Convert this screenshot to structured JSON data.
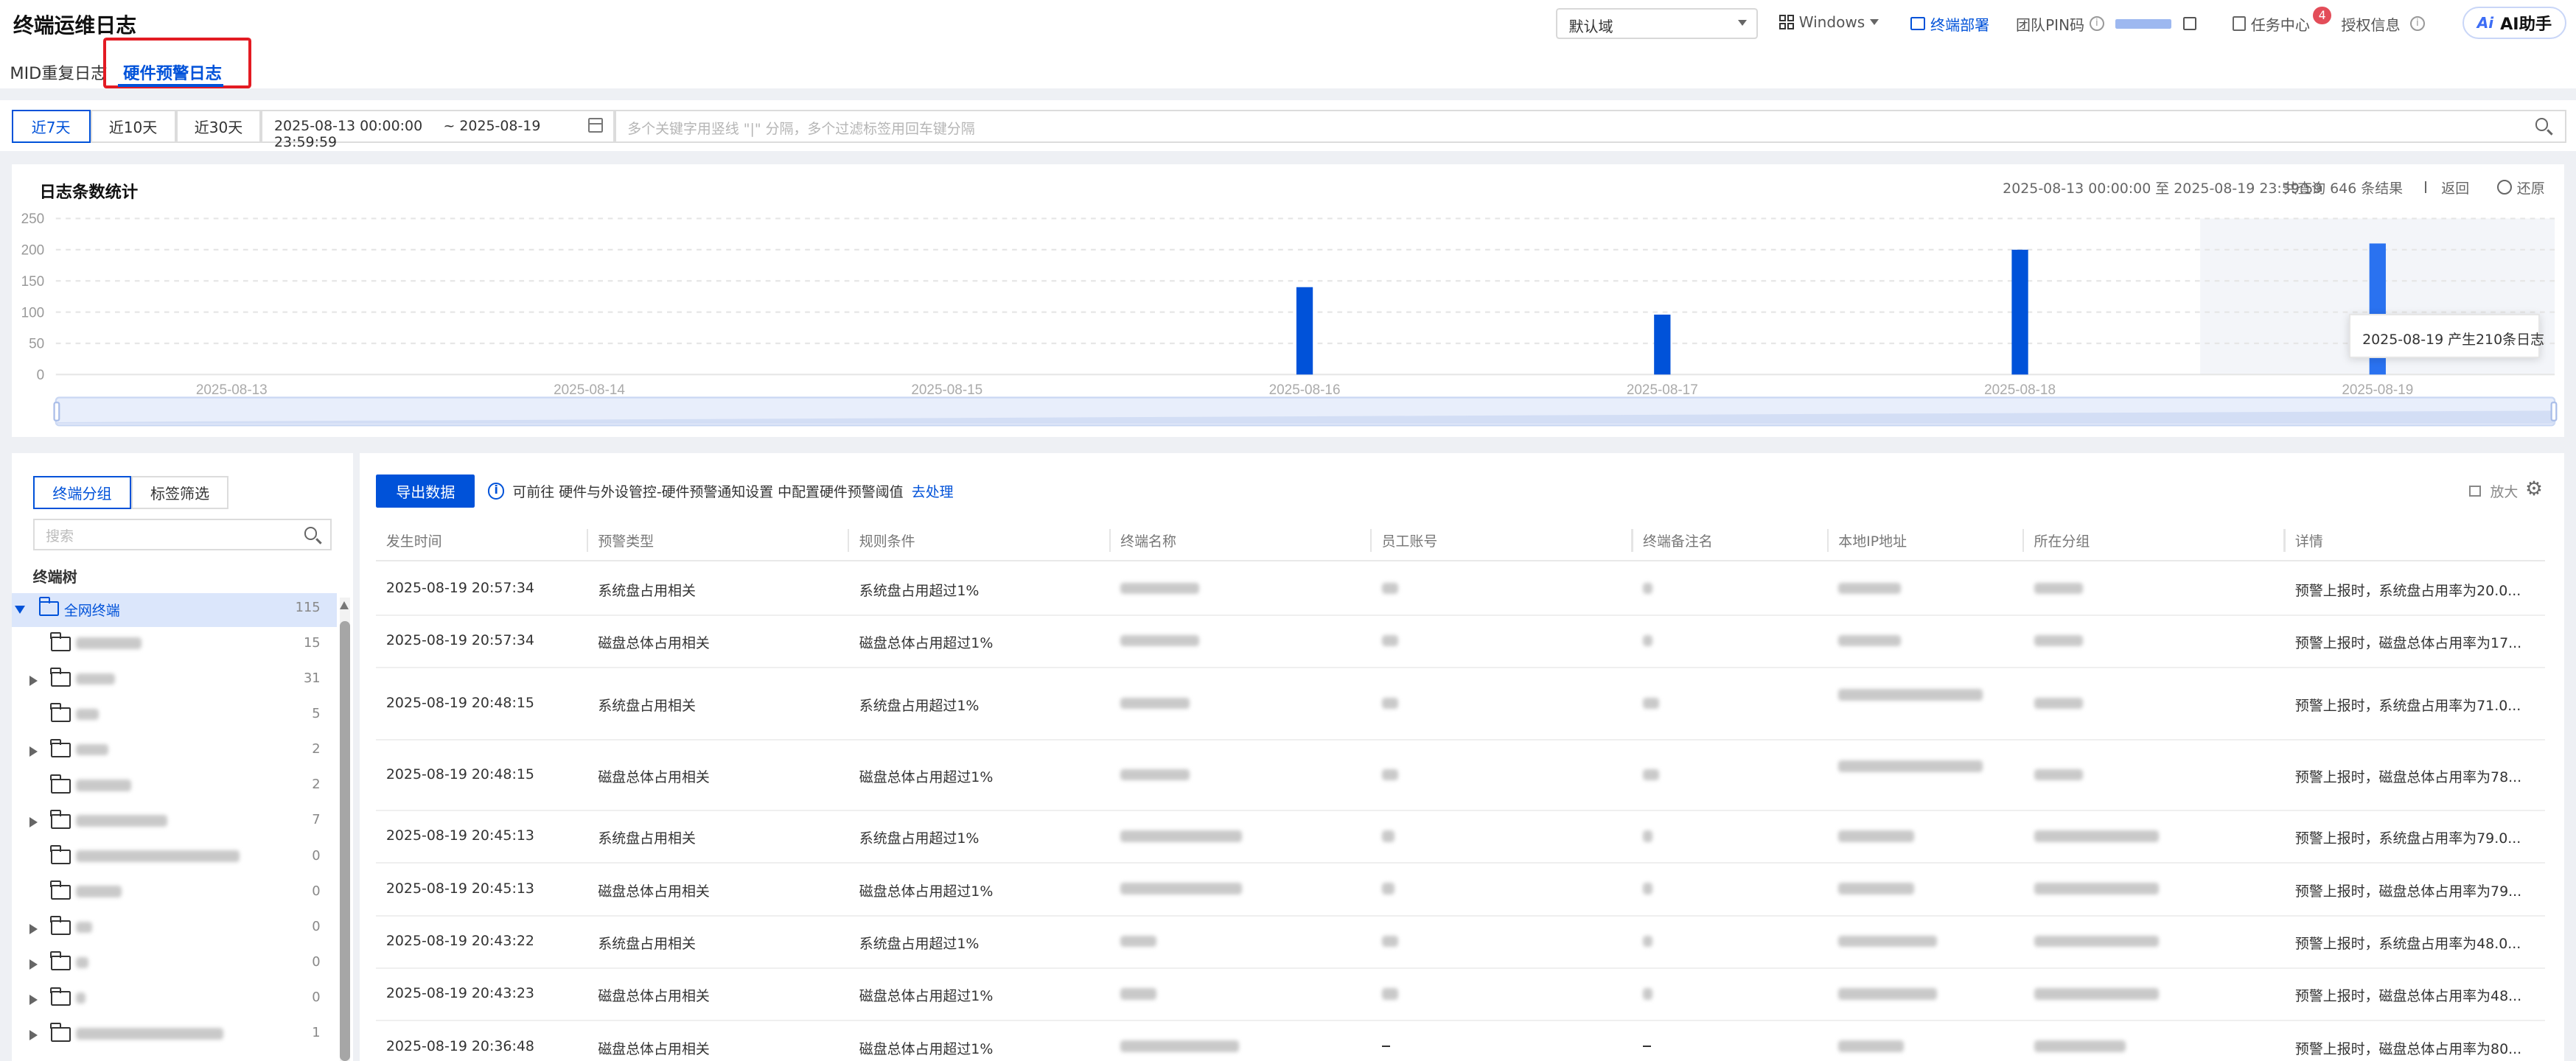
{
  "header": {
    "title": "终端运维日志",
    "domain_select": "默认域",
    "os_select": "Windows",
    "deploy_label": "终端部署",
    "team_pin_label": "团队PIN码",
    "task_center_label": "任务中心",
    "task_badge": "4",
    "license_label": "授权信息",
    "ai_label": "AI助手",
    "ai_logo": "Ai"
  },
  "tabs": [
    {
      "label": "MID重复日志",
      "active": false
    },
    {
      "label": "硬件预警日志",
      "active": true
    }
  ],
  "filter": {
    "ranges": [
      "近7天",
      "近10天",
      "近30天"
    ],
    "active_range": "近7天",
    "date_start": "2025-08-13 00:00:00",
    "date_end": "~ 2025-08-19 23:59:59",
    "search_placeholder": "多个关键字用竖线 \"|\" 分隔，多个过滤标签用回车键分隔"
  },
  "chart_panel": {
    "title": "日志条数统计",
    "range_text": "2025-08-13 00:00:00 至 2025-08-19 23:59:59",
    "total_text": "共查询 646 条结果",
    "back_label": "返回",
    "reset_label": "还原",
    "tooltip": "2025-08-19 产生210条日志"
  },
  "chart_data": {
    "type": "bar",
    "categories": [
      "2025-08-13",
      "2025-08-14",
      "2025-08-15",
      "2025-08-16",
      "2025-08-17",
      "2025-08-18",
      "2025-08-19"
    ],
    "values": [
      0,
      0,
      0,
      140,
      96,
      200,
      210
    ],
    "ylim": [
      0,
      250
    ],
    "yticks": [
      0,
      50,
      100,
      150,
      200,
      250
    ],
    "grid": true,
    "color": "#0052d9",
    "highlight_category": "2025-08-19"
  },
  "left_panel": {
    "seg_tabs": [
      "终端分组",
      "标签筛选"
    ],
    "search_placeholder": "搜索",
    "tree_label": "终端树",
    "tree": [
      {
        "name": "全网终端",
        "count": "115",
        "level": 0,
        "expanded": true,
        "selected": true,
        "blurred": false
      },
      {
        "name": "",
        "count": "15",
        "level": 1,
        "expanded": false,
        "hasChildren": false,
        "blurred": true,
        "blur_w": 40
      },
      {
        "name": "",
        "count": "31",
        "level": 1,
        "expanded": false,
        "hasChildren": true,
        "blurred": true,
        "blur_w": 24
      },
      {
        "name": "",
        "count": "5",
        "level": 1,
        "expanded": false,
        "hasChildren": false,
        "blurred": true,
        "blur_w": 14
      },
      {
        "name": "",
        "count": "2",
        "level": 1,
        "expanded": false,
        "hasChildren": true,
        "blurred": true,
        "blur_w": 20
      },
      {
        "name": "",
        "count": "2",
        "level": 1,
        "expanded": false,
        "hasChildren": false,
        "blurred": true,
        "blur_w": 34
      },
      {
        "name": "",
        "count": "7",
        "level": 1,
        "expanded": false,
        "hasChildren": true,
        "blurred": true,
        "blur_w": 56
      },
      {
        "name": "",
        "count": "0",
        "level": 1,
        "expanded": false,
        "hasChildren": false,
        "blurred": true,
        "blur_w": 100
      },
      {
        "name": "",
        "count": "0",
        "level": 1,
        "expanded": false,
        "hasChildren": false,
        "blurred": true,
        "blur_w": 28
      },
      {
        "name": "",
        "count": "0",
        "level": 1,
        "expanded": false,
        "hasChildren": true,
        "blurred": true,
        "blur_w": 10
      },
      {
        "name": "",
        "count": "0",
        "level": 1,
        "expanded": false,
        "hasChildren": true,
        "blurred": true,
        "blur_w": 8
      },
      {
        "name": "",
        "count": "0",
        "level": 1,
        "expanded": false,
        "hasChildren": true,
        "blurred": true,
        "blur_w": 6
      },
      {
        "name": "",
        "count": "1",
        "level": 1,
        "expanded": false,
        "hasChildren": true,
        "blurred": true,
        "blur_w": 90
      }
    ]
  },
  "table": {
    "export_label": "导出数据",
    "notice_prefix": "可前往 硬件与外设管控-硬件预警通知设置 中配置硬件预警阈值",
    "notice_link": "去处理",
    "enlarge_label": "放大",
    "columns": [
      "发生时间",
      "预警类型",
      "规则条件",
      "终端名称",
      "员工账号",
      "终端备注名",
      "本地IP地址",
      "所在分组",
      "详情"
    ],
    "rows": [
      {
        "time": "2025-08-19 20:57:34",
        "type": "系统盘占用相关",
        "rule": "系统盘占用超过1%",
        "detail": "预警上报时，系统盘占用率为20.0..."
      },
      {
        "time": "2025-08-19 20:57:34",
        "type": "磁盘总体占用相关",
        "rule": "磁盘总体占用超过1%",
        "detail": "预警上报时，磁盘总体占用率为17..."
      },
      {
        "time": "2025-08-19 20:48:15",
        "type": "系统盘占用相关",
        "rule": "系统盘占用超过1%",
        "detail": "预警上报时，系统盘占用率为71.0..."
      },
      {
        "time": "2025-08-19 20:48:15",
        "type": "磁盘总体占用相关",
        "rule": "磁盘总体占用超过1%",
        "detail": "预警上报时，磁盘总体占用率为78..."
      },
      {
        "time": "2025-08-19 20:45:13",
        "type": "系统盘占用相关",
        "rule": "系统盘占用超过1%",
        "detail": "预警上报时，系统盘占用率为79.0..."
      },
      {
        "time": "2025-08-19 20:45:13",
        "type": "磁盘总体占用相关",
        "rule": "磁盘总体占用超过1%",
        "detail": "预警上报时，磁盘总体占用率为79..."
      },
      {
        "time": "2025-08-19 20:43:22",
        "type": "系统盘占用相关",
        "rule": "系统盘占用超过1%",
        "detail": "预警上报时，系统盘占用率为48.0..."
      },
      {
        "time": "2025-08-19 20:43:23",
        "type": "磁盘总体占用相关",
        "rule": "磁盘总体占用超过1%",
        "detail": "预警上报时，磁盘总体占用率为48..."
      },
      {
        "time": "2025-08-19 20:36:48",
        "type": "磁盘总体占用相关",
        "rule": "磁盘总体占用超过1%",
        "detail": "预警上报时，磁盘总体占用率为80..."
      }
    ]
  }
}
